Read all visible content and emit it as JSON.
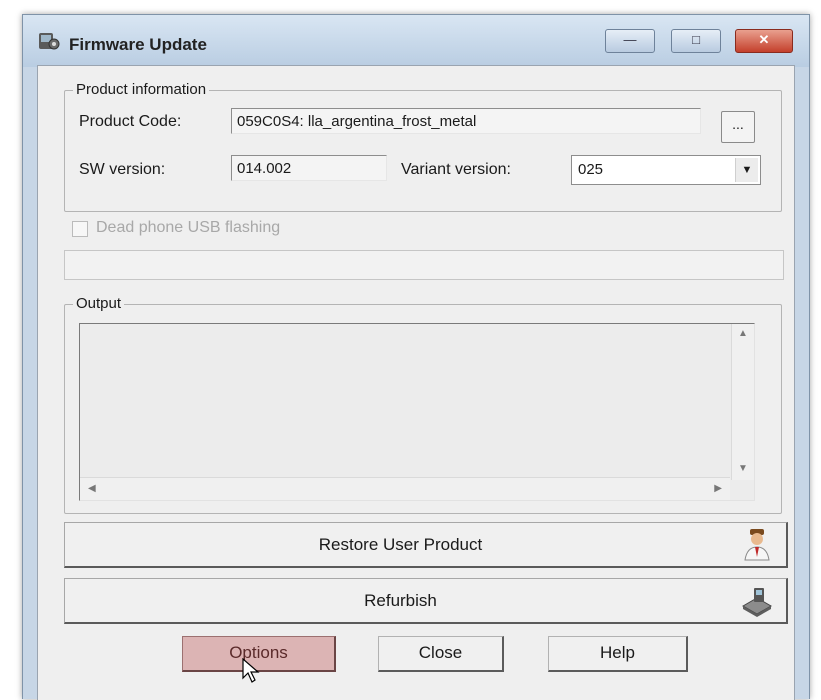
{
  "window": {
    "title": "Firmware Update",
    "icon": "firmware-app-icon",
    "controls": {
      "minimize": "minimize-icon",
      "maximize": "maximize-icon",
      "close": "close-icon"
    }
  },
  "product_info": {
    "group_label": "Product information",
    "product_code_label": "Product Code:",
    "product_code_value": "059C0S4: lla_argentina_frost_metal",
    "browse_label": "...",
    "sw_version_label": "SW version:",
    "sw_version_value": "014.002",
    "variant_version_label": "Variant version:",
    "variant_version_value": "025"
  },
  "dead_phone": {
    "label": "Dead phone USB flashing",
    "checked": false,
    "enabled": false
  },
  "progress": {
    "value": 0
  },
  "output": {
    "group_label": "Output",
    "content": ""
  },
  "actions": {
    "restore_label": "Restore User Product",
    "restore_icon": "user-icon",
    "refurbish_label": "Refurbish",
    "refurbish_icon": "refurbish-device-icon"
  },
  "footer": {
    "options_label": "Options",
    "close_label": "Close",
    "help_label": "Help"
  },
  "colors": {
    "options_button_highlight": "#dcb4b4",
    "close_titlebar_button": "#c4402c"
  }
}
